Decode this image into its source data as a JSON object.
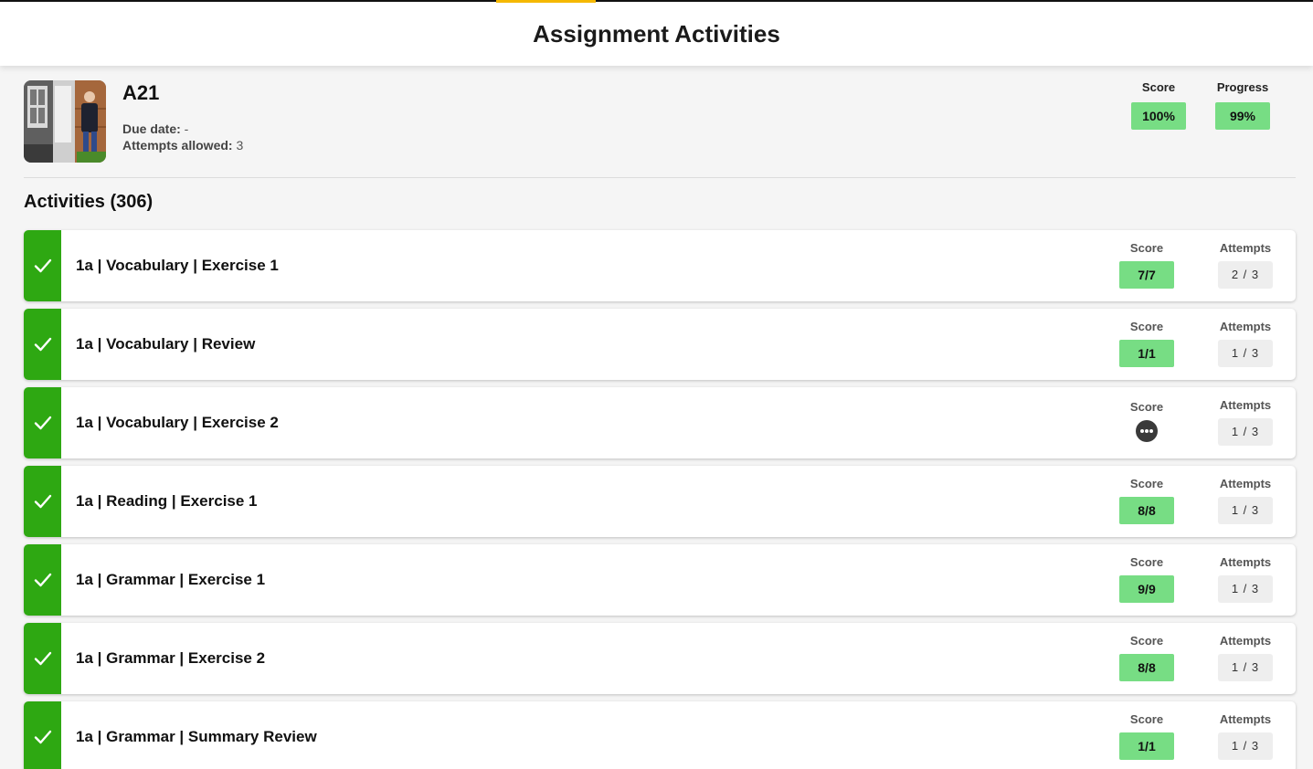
{
  "page": {
    "title": "Assignment Activities"
  },
  "assignment": {
    "name": "A21",
    "due_label": "Due date:",
    "due_value": " -",
    "attempts_label": "Attempts allowed:",
    "attempts_value": " 3",
    "score_label": "Score",
    "score_value": "100%",
    "progress_label": "Progress",
    "progress_value": "99%"
  },
  "activities": {
    "heading": "Activities (306)",
    "score_label": "Score",
    "attempts_label": "Attempts",
    "items": [
      {
        "name": "1a | Vocabulary | Exercise 1",
        "score": "7/7",
        "attempts": "2 / 3",
        "status": "completed"
      },
      {
        "name": "1a | Vocabulary | Review",
        "score": "1/1",
        "attempts": "1 / 3",
        "status": "completed"
      },
      {
        "name": "1a | Vocabulary | Exercise 2",
        "score": null,
        "attempts": "1 / 3",
        "status": "completed",
        "score_state": "pending"
      },
      {
        "name": "1a | Reading | Exercise 1",
        "score": "8/8",
        "attempts": "1 / 3",
        "status": "completed"
      },
      {
        "name": "1a | Grammar | Exercise 1",
        "score": "9/9",
        "attempts": "1 / 3",
        "status": "completed"
      },
      {
        "name": "1a | Grammar | Exercise 2",
        "score": "8/8",
        "attempts": "1 / 3",
        "status": "completed"
      },
      {
        "name": "1a | Grammar | Summary Review",
        "score": "1/1",
        "attempts": "1 / 3",
        "status": "completed"
      }
    ]
  },
  "icons": {
    "status": "check-icon",
    "pending": "more-horizontal-icon",
    "thumbnail": "assignment-thumbnail"
  },
  "colors": {
    "accent": "#f5b800",
    "success": "#2ea812",
    "score_pill": "#77dd84",
    "attempts_pill": "#eeeeee"
  }
}
